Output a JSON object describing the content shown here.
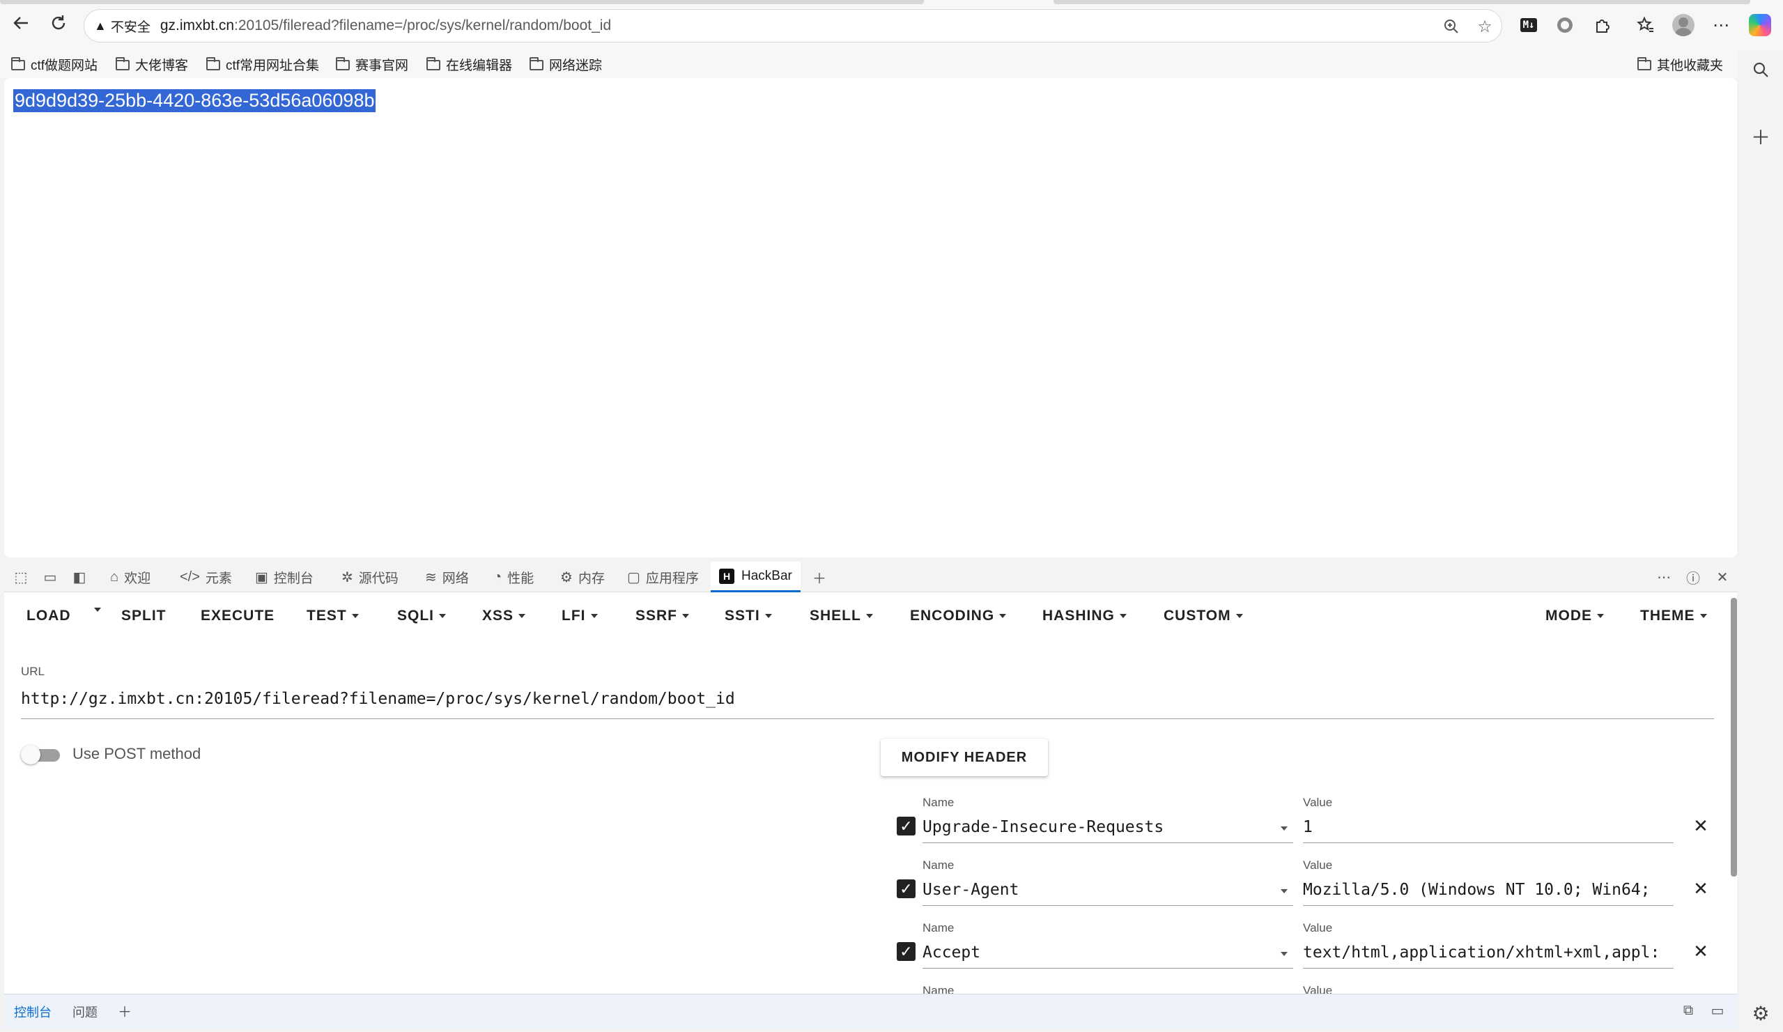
{
  "browser": {
    "address": {
      "security_label": "不安全",
      "host": "gz.imxbt.cn",
      "rest": ":20105/fileread?filename=/proc/sys/kernel/random/boot_id"
    },
    "icons": {
      "back": "back-arrow-icon",
      "reload": "reload-icon",
      "zoom": "zoom-icon",
      "favorite": "star-icon",
      "markdown_badge": "M↓"
    }
  },
  "bookmarks": [
    {
      "label": "ctf做题网站"
    },
    {
      "label": "大佬博客"
    },
    {
      "label": "ctf常用网址合集"
    },
    {
      "label": "赛事官网"
    },
    {
      "label": "在线编辑器"
    },
    {
      "label": "网络迷踪"
    }
  ],
  "bookmarks_other": "其他收藏夹",
  "page": {
    "content": "9d9d9d39-25bb-4420-863e-53d56a06098b"
  },
  "devtools": {
    "tabs": [
      {
        "label": "欢迎",
        "icon": "home-icon"
      },
      {
        "label": "元素",
        "icon": "code-icon"
      },
      {
        "label": "控制台",
        "icon": "console-icon"
      },
      {
        "label": "源代码",
        "icon": "bug-icon"
      },
      {
        "label": "网络",
        "icon": "wifi-icon"
      },
      {
        "label": "性能",
        "icon": "gauge-icon"
      },
      {
        "label": "内存",
        "icon": "chip-icon"
      },
      {
        "label": "应用程序",
        "icon": "app-icon"
      },
      {
        "label": "HackBar",
        "icon": "hackbar-icon",
        "active": true
      }
    ],
    "drawer_tabs": [
      "控制台",
      "问题"
    ]
  },
  "hackbar": {
    "menu": {
      "load": "LOAD",
      "split": "SPLIT",
      "execute": "EXECUTE",
      "test": "TEST",
      "sqli": "SQLI",
      "xss": "XSS",
      "lfi": "LFI",
      "ssrf": "SSRF",
      "ssti": "SSTI",
      "shell": "SHELL",
      "encoding": "ENCODING",
      "hashing": "HASHING",
      "custom": "CUSTOM",
      "mode": "MODE",
      "theme": "THEME"
    },
    "url_label": "URL",
    "url": "http://gz.imxbt.cn:20105/fileread?filename=/proc/sys/kernel/random/boot_id",
    "post_label": "Use POST method",
    "post_enabled": false,
    "modify_header": "MODIFY HEADER",
    "name_label": "Name",
    "value_label": "Value",
    "headers": [
      {
        "checked": true,
        "name": "Upgrade-Insecure-Requests",
        "value": "1"
      },
      {
        "checked": true,
        "name": "User-Agent",
        "value": "Mozilla/5.0 (Windows NT 10.0; Win64;"
      },
      {
        "checked": true,
        "name": "Accept",
        "value": "text/html,application/xhtml+xml,appl:"
      }
    ]
  }
}
